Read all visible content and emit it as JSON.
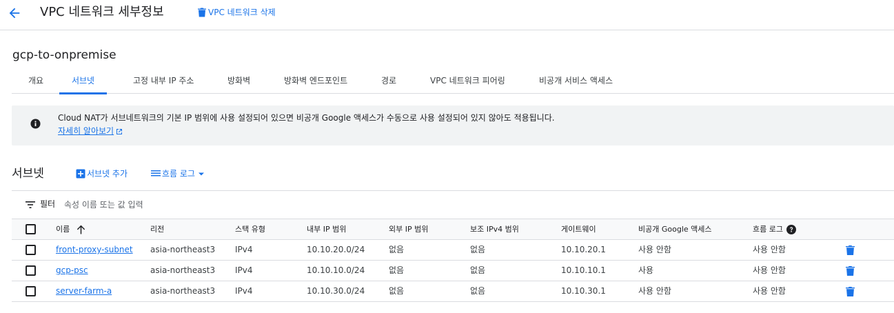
{
  "header": {
    "title": "VPC 네트워크 세부정보",
    "delete_label": "VPC 네트워크 삭제"
  },
  "network": {
    "name": "gcp-to-onpremise"
  },
  "tabs": [
    {
      "label": "개요"
    },
    {
      "label": "서브넷"
    },
    {
      "label": "고정 내부 IP 주소"
    },
    {
      "label": "방화벽"
    },
    {
      "label": "방화벽 엔드포인트"
    },
    {
      "label": "경로"
    },
    {
      "label": "VPC 네트워크 피어링"
    },
    {
      "label": "비공개 서비스 액세스"
    }
  ],
  "active_tab": "서브넷",
  "info": {
    "text": "Cloud NAT가 서브네트워크의 기본 IP 범위에 사용 설정되어 있으면 비공개 Google 액세스가 수동으로 사용 설정되어 있지 않아도 적용됩니다.",
    "link": "자세히 알아보기"
  },
  "subnets": {
    "title": "서브넷",
    "add_label": "서브넷 추가",
    "flow_logs_label": "흐름 로그"
  },
  "filter": {
    "label": "필터",
    "placeholder": "속성 이름 또는 값 입력"
  },
  "table": {
    "columns": [
      "이름",
      "리전",
      "스택 유형",
      "내부 IP 범위",
      "외부 IP 범위",
      "보조 IPv4 범위",
      "게이트웨이",
      "비공개 Google 액세스",
      "흐름 로그"
    ],
    "rows": [
      [
        "front-proxy-subnet",
        "asia-northeast3",
        "IPv4",
        "10.10.20.0/24",
        "없음",
        "없음",
        "10.10.20.1",
        "사용 안함",
        "사용 안함"
      ],
      [
        "gcp-psc",
        "asia-northeast3",
        "IPv4",
        "10.10.10.0/24",
        "없음",
        "없음",
        "10.10.10.1",
        "사용",
        "사용 안함"
      ],
      [
        "server-farm-a",
        "asia-northeast3",
        "IPv4",
        "10.10.30.0/24",
        "없음",
        "없음",
        "10.10.30.1",
        "사용 안함",
        "사용 안함"
      ]
    ]
  },
  "colors": {
    "accent": "#1a73e8",
    "text": "#202124",
    "border": "#dadce0",
    "banner_bg": "#f1f3f4"
  },
  "icons": {
    "back": "arrow-left-icon",
    "delete": "trash-icon",
    "info": "info-icon",
    "external": "external-link-icon",
    "add": "add-box-icon",
    "flow": "list-icon",
    "dropdown": "caret-down-icon",
    "filter": "filter-icon",
    "sort": "arrow-up-icon",
    "help": "help-icon"
  }
}
